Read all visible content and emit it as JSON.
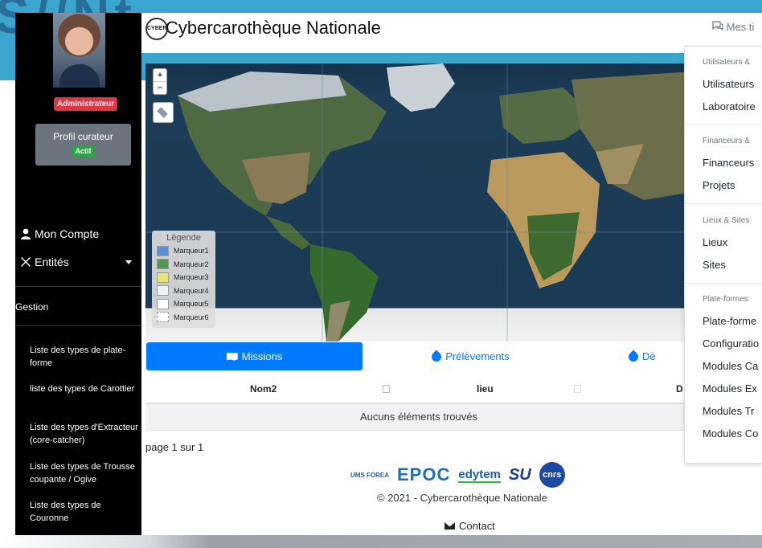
{
  "sidebar": {
    "role_badge": "Administrateur",
    "curator_title": "Profil curateur",
    "curator_status": "Actif",
    "nav": [
      {
        "label": "Mon Compte",
        "icon": "user-icon"
      },
      {
        "label": "Entités",
        "icon": "tools-icon"
      }
    ],
    "section_label": "Gestion",
    "links": [
      "Liste des types de plate-forme",
      "liste des types de Carottier",
      "Liste des types d'Extracteur (core-catcher)",
      "Liste des types de Trousse coupante / Ogive",
      "Liste des types de Couronne"
    ]
  },
  "header": {
    "title": "Cybercarothèque Nationale",
    "logo_text": "CYBER",
    "tickets": "Mes ti"
  },
  "map": {
    "zoom_in": "+",
    "zoom_out": "−",
    "legend_title": "Légende",
    "legend": [
      {
        "label": "Marqueur1",
        "color": "#5b8fd6"
      },
      {
        "label": "Marqueur2",
        "color": "#4f9a4c"
      },
      {
        "label": "Marqueur3",
        "color": "#e8e37f"
      },
      {
        "label": "Marqueur4",
        "color": "#f0f0f0"
      },
      {
        "label": "Marqueur5",
        "color": "#ffffff"
      },
      {
        "label": "Marqueur6",
        "color": "#ffffff"
      }
    ]
  },
  "tabs": [
    "Missions",
    "Prélèvements",
    "Dé"
  ],
  "table": {
    "columns": [
      "Nom2",
      "lieu",
      "D"
    ],
    "empty_message": "Aucuns éléments trouvés",
    "pagination": "page 1 sur 1"
  },
  "footer": {
    "logos": {
      "ums": "UMS FOREA",
      "epoc": "EPOC",
      "edytem": "edytem",
      "osu": "SU",
      "cnrs": "cnrs"
    },
    "copyright": "© 2021 - Cybercarothèque Nationale",
    "contact": "Contact"
  },
  "menu": {
    "sections": [
      {
        "header": "Utilisateurs &",
        "items": [
          "Utilisateurs",
          "Laboratoire"
        ]
      },
      {
        "header": "Financeurs &",
        "items": [
          "Financeurs",
          "Projets"
        ]
      },
      {
        "header": "Lieux & Sites",
        "items": [
          "Lieux",
          "Sites"
        ]
      },
      {
        "header": "Plate-formes",
        "items": [
          "Plate-forme",
          "Configuratio",
          "Modules Ca",
          "Modules Ex",
          "Modules Tr",
          "Modules Co"
        ]
      }
    ]
  },
  "colors": {
    "primary": "#007bff",
    "danger": "#dc3545",
    "success": "#28a745",
    "sidebar": "#000000"
  }
}
